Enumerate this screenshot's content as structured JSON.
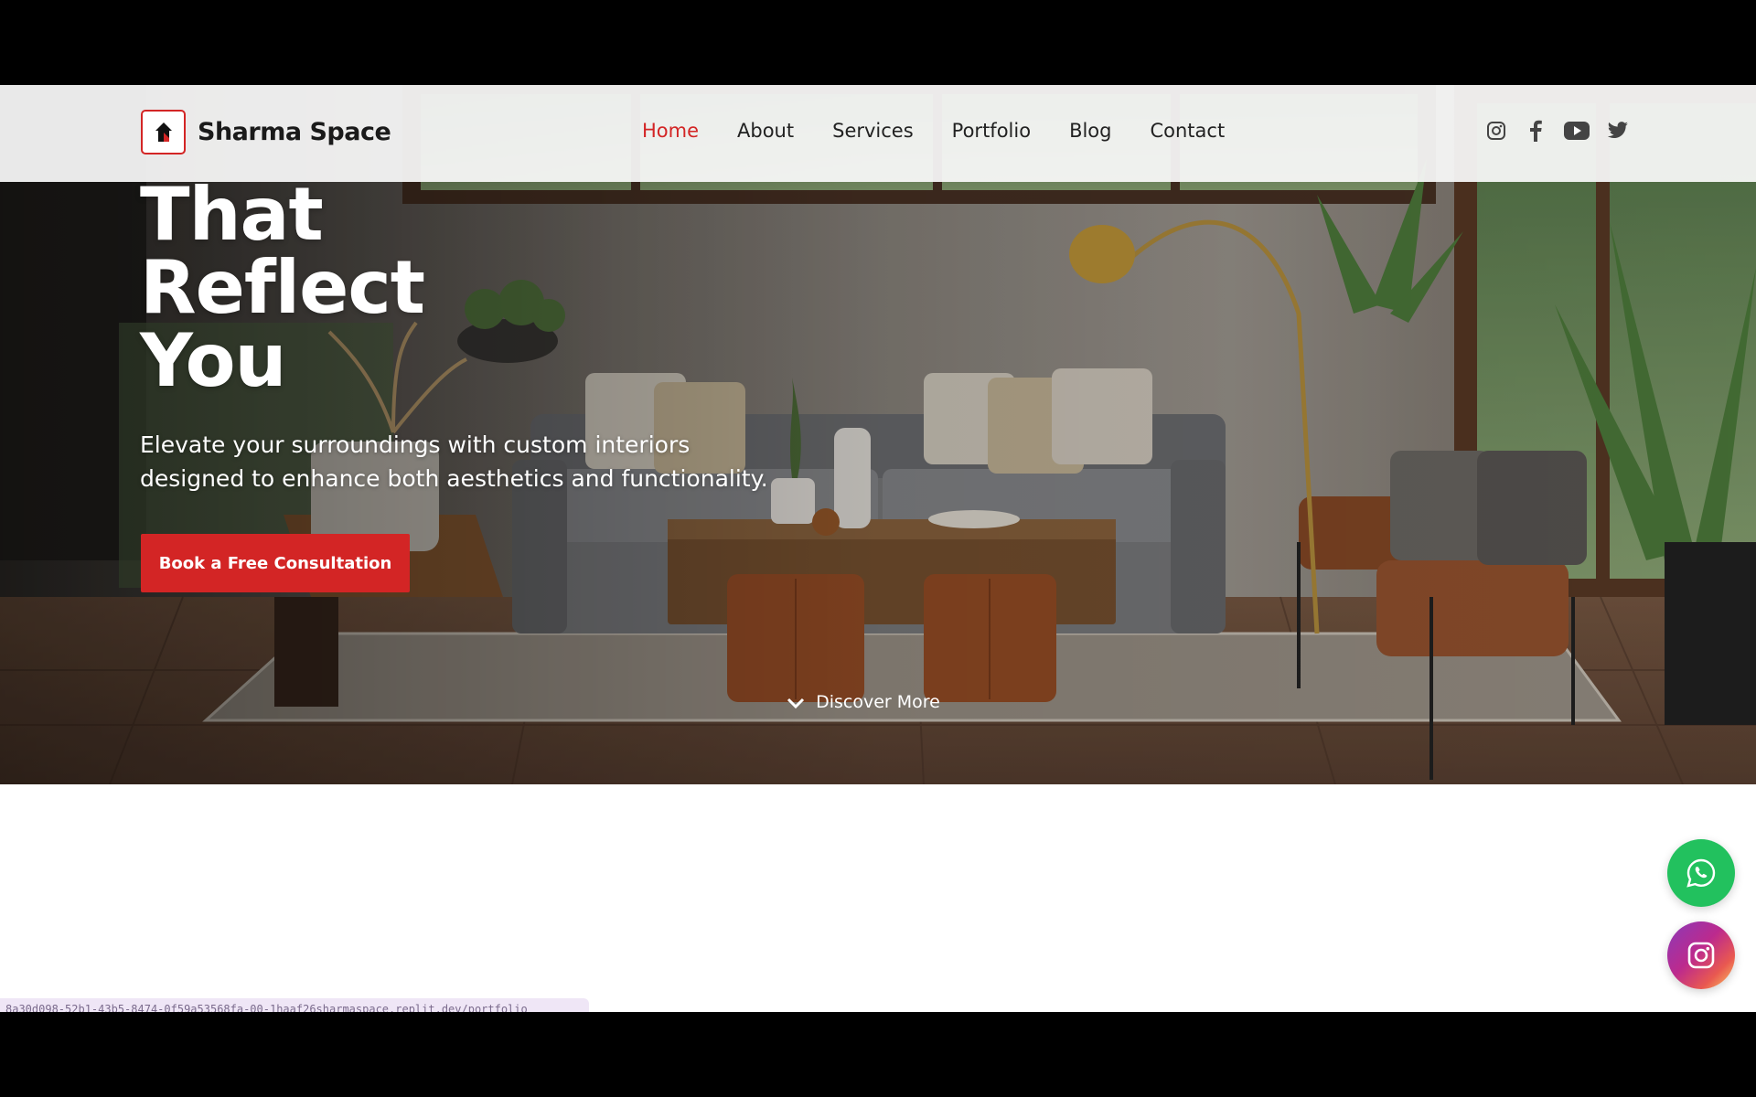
{
  "brand": {
    "name": "Sharma Space"
  },
  "nav": {
    "items": [
      {
        "label": "Home",
        "active": true
      },
      {
        "label": "About",
        "active": false
      },
      {
        "label": "Services",
        "active": false
      },
      {
        "label": "Portfolio",
        "active": false
      },
      {
        "label": "Blog",
        "active": false
      },
      {
        "label": "Contact",
        "active": false
      }
    ]
  },
  "social_icons": [
    "instagram-icon",
    "facebook-icon",
    "youtube-icon",
    "twitter-icon"
  ],
  "hero": {
    "headline_lines": [
      "That",
      "Reflect",
      "You"
    ],
    "subtitle": "Elevate your surroundings with custom interiors designed to enhance both aesthetics and functionality.",
    "cta_label": "Book a Free Consultation",
    "discover_label": "Discover More"
  },
  "floating_buttons": [
    "whatsapp-icon",
    "instagram-icon"
  ],
  "status_url": "8a30d098-52b1-43b5-8474-0f59a53568fa-00-1haaf26sharmaspace.replit.dev/portfolio",
  "colors": {
    "accent": "#d32525",
    "whatsapp": "#22c15e",
    "navbar_bg": "#fafafa",
    "text_dark": "#222222"
  }
}
